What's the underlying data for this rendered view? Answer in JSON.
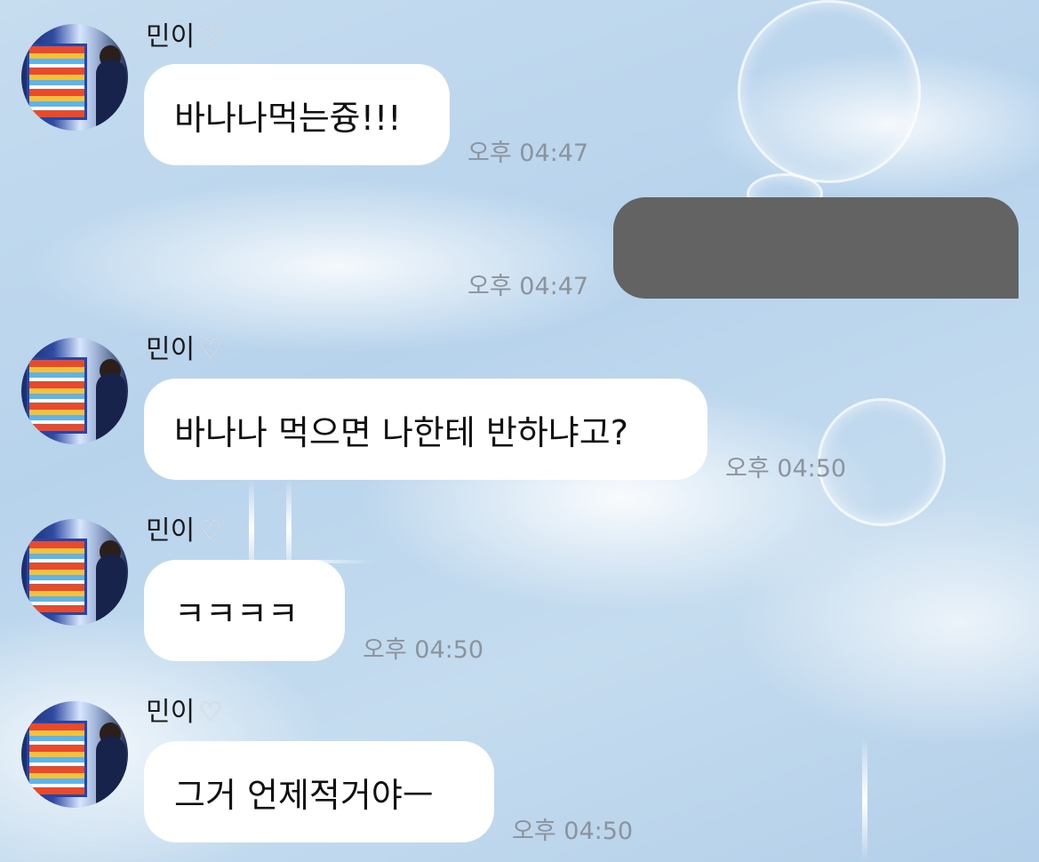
{
  "conversation": {
    "messages": [
      {
        "sender": "민이",
        "text": "바나나먹는즁!!!",
        "time": "오후 04:47"
      },
      {
        "sender": "me",
        "text": "",
        "time": "오후 04:47",
        "redacted": true
      },
      {
        "sender": "민이",
        "text": "바나나 먹으면 나한테 반하냐고?",
        "time": "오후 04:50"
      },
      {
        "sender": "민이",
        "text": "ㅋㅋㅋㅋ",
        "time": "오후 04:50"
      },
      {
        "sender": "민이",
        "text": "그거 언제적거야ㅡ",
        "time": "오후 04:50"
      }
    ],
    "sender_name": "민이",
    "heart_icon": "white-heart-icon",
    "redacted_color": "#636363",
    "bubble_color": "#ffffff"
  }
}
